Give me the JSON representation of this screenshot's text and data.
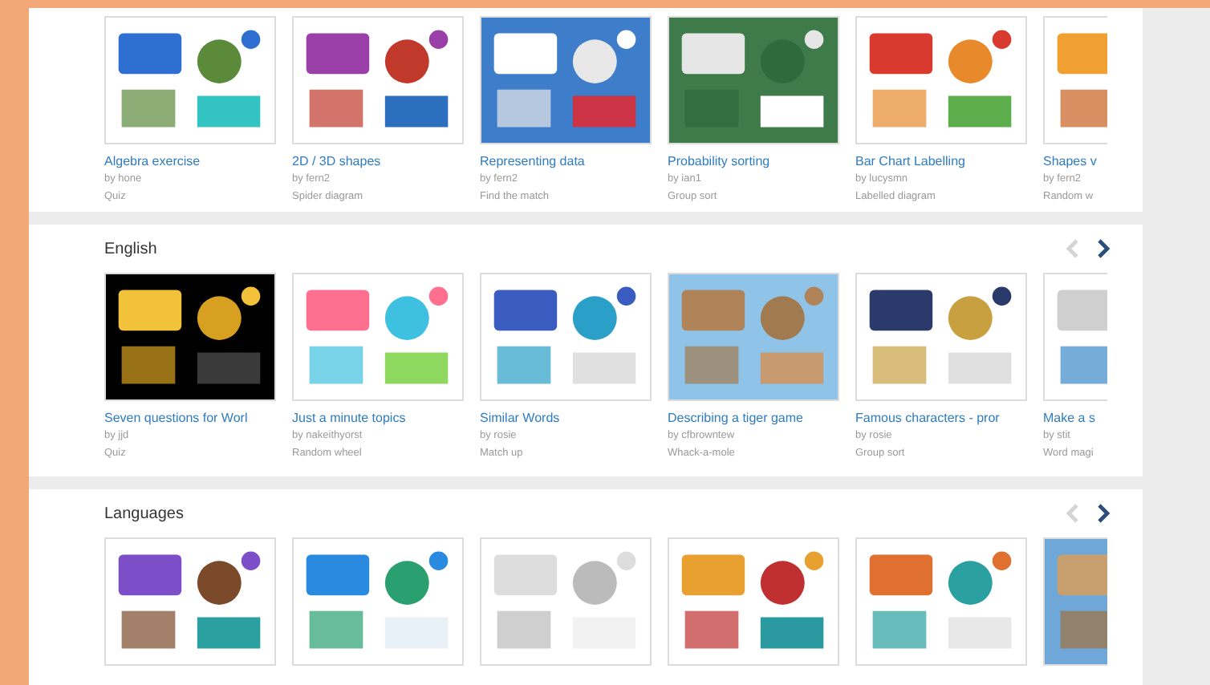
{
  "sections": [
    {
      "cards": [
        {
          "title": "Algebra exercise",
          "author": "by hone",
          "type": "Quiz"
        },
        {
          "title": "2D / 3D shapes",
          "author": "by fern2",
          "type": "Spider diagram"
        },
        {
          "title": "Representing data",
          "author": "by fern2",
          "type": "Find the match"
        },
        {
          "title": "Probability sorting",
          "author": "by ian1",
          "type": "Group sort"
        },
        {
          "title": "Bar Chart Labelling",
          "author": "by lucysmn",
          "type": "Labelled diagram"
        },
        {
          "title": "Shapes v",
          "author": "by fern2",
          "type": "Random w"
        }
      ]
    },
    {
      "title": "English",
      "prev": {
        "disabled": true
      },
      "next": {
        "disabled": false
      },
      "cards": [
        {
          "title": "Seven questions for Worl",
          "author": "by jjd",
          "type": "Quiz"
        },
        {
          "title": "Just a minute topics",
          "author": "by nakeithyorst",
          "type": "Random wheel"
        },
        {
          "title": "Similar Words",
          "author": "by rosie",
          "type": "Match up"
        },
        {
          "title": "Describing a tiger game",
          "author": "by cfbrowntew",
          "type": "Whack-a-mole"
        },
        {
          "title": "Famous characters - pror",
          "author": "by rosie",
          "type": "Group sort"
        },
        {
          "title": "Make a s",
          "author": "by stit",
          "type": "Word magi"
        }
      ]
    },
    {
      "title": "Languages",
      "prev": {
        "disabled": true
      },
      "next": {
        "disabled": false
      }
    }
  ]
}
